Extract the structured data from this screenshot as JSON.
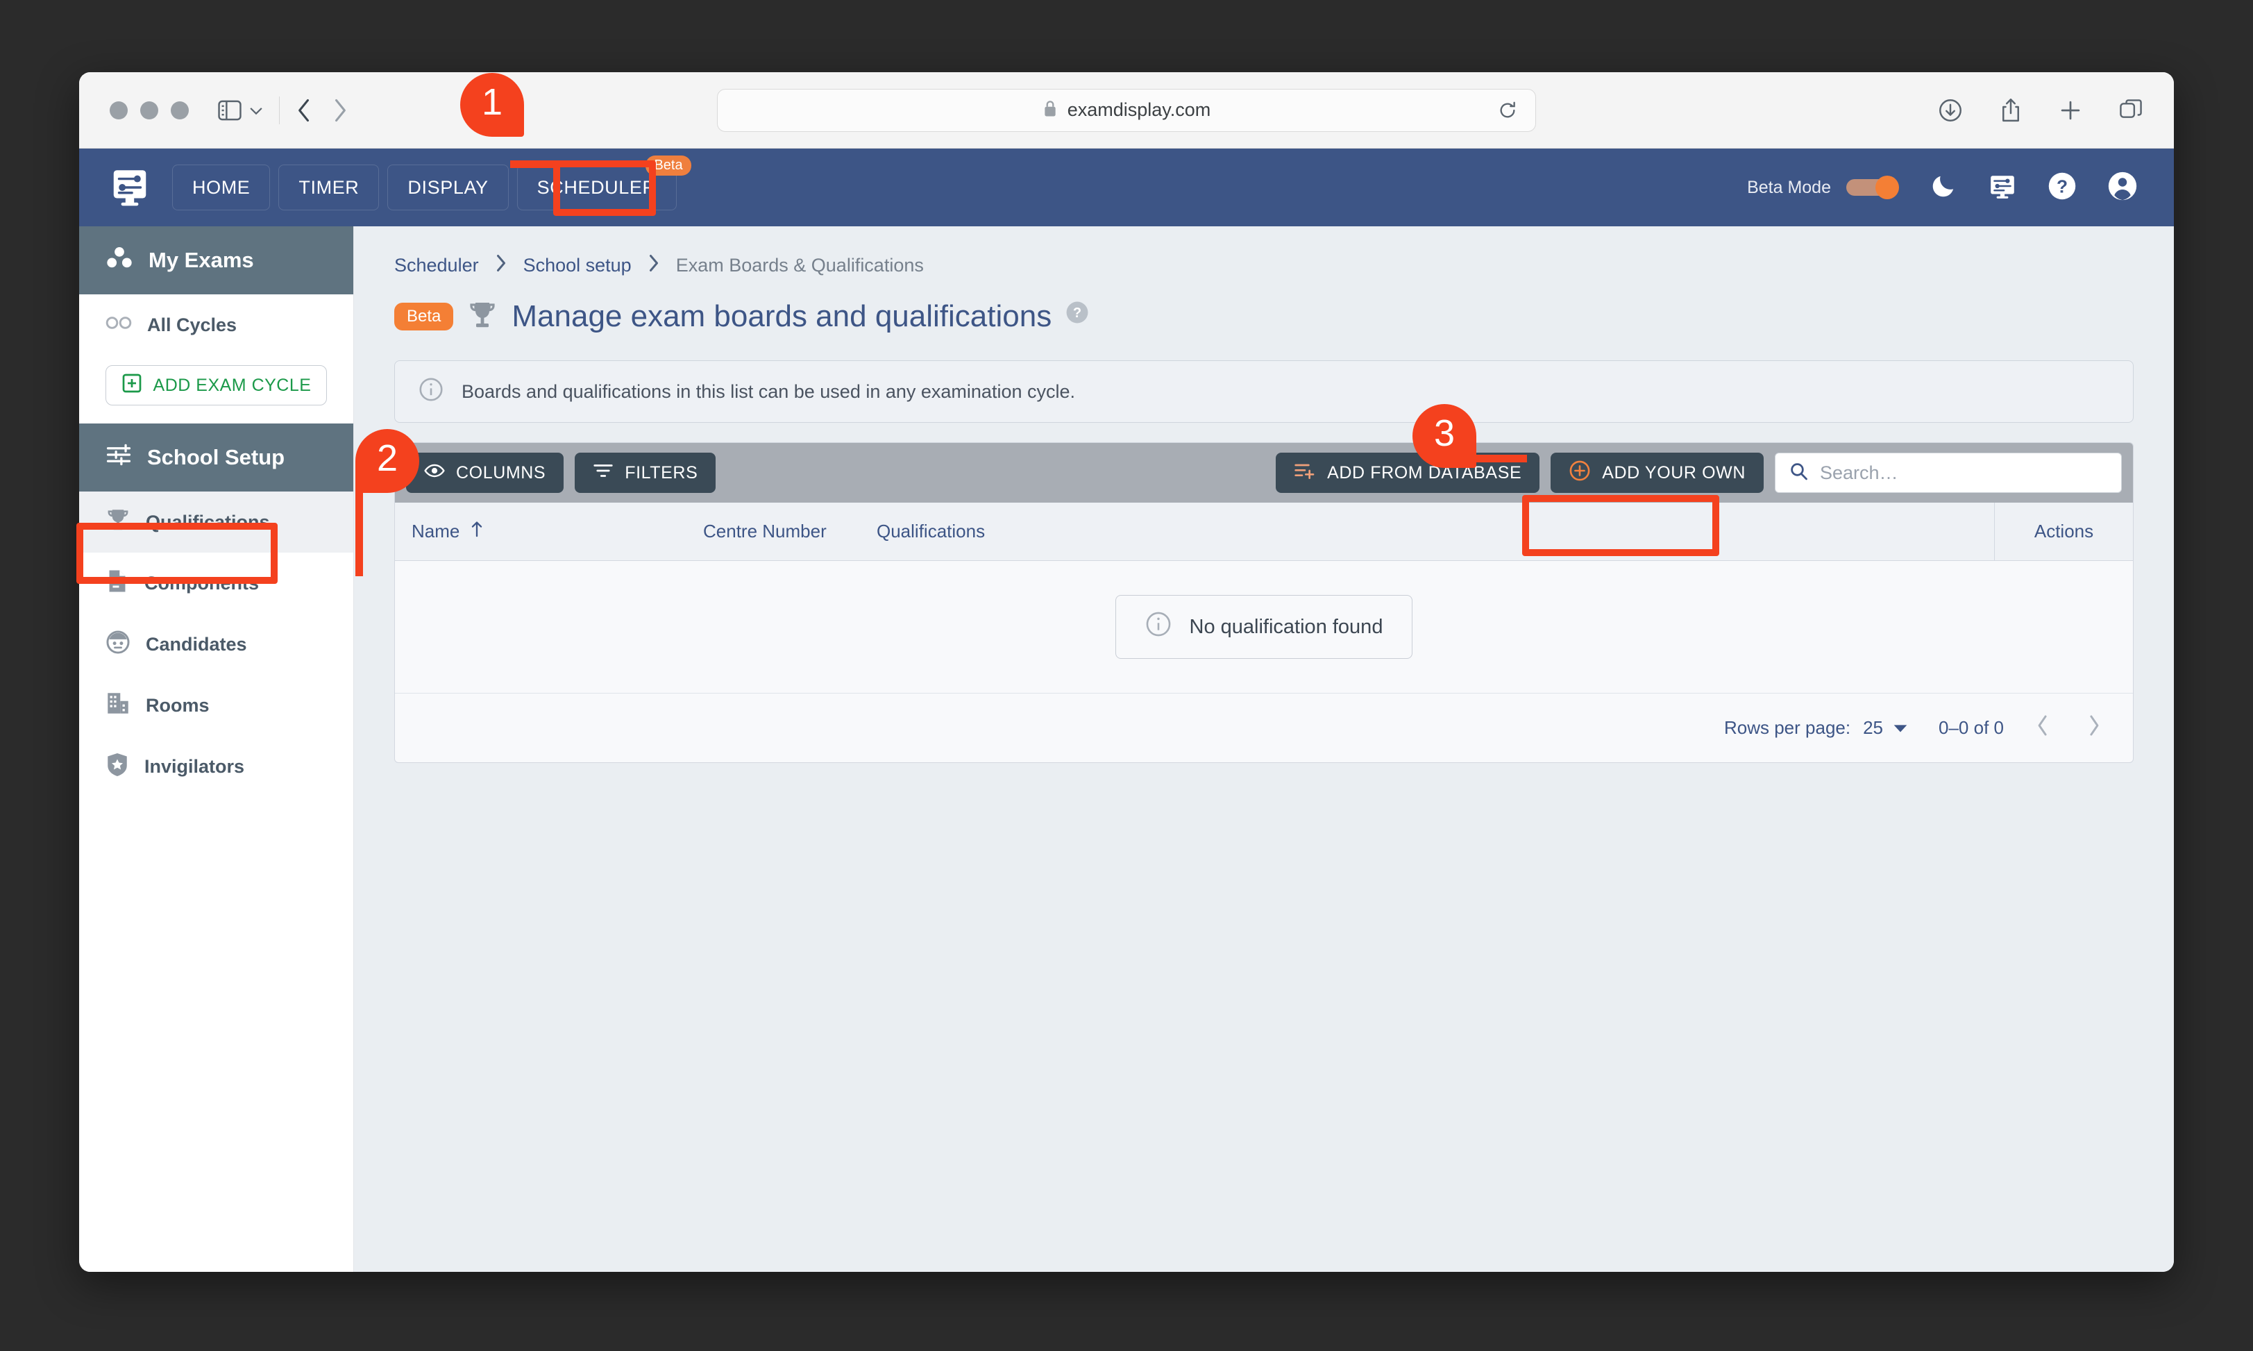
{
  "browser": {
    "url": "examdisplay.com",
    "lock_icon": "lock-icon",
    "reload_icon": "reload-icon",
    "back_icon": "chevron-left-icon",
    "forward_icon": "chevron-right-icon",
    "sidebar_icon": "sidebar-toggle-icon",
    "downloads_icon": "download-icon",
    "share_icon": "share-icon",
    "new_tab_icon": "plus-icon",
    "tab_overview_icon": "tab-overview-icon"
  },
  "topnav": {
    "logo_icon": "exam-display-logo-icon",
    "tabs": [
      {
        "label": "HOME",
        "badge": null
      },
      {
        "label": "TIMER",
        "badge": null
      },
      {
        "label": "DISPLAY",
        "badge": null
      },
      {
        "label": "SCHEDULER",
        "badge": "Beta"
      }
    ],
    "beta_mode_label": "Beta Mode",
    "beta_mode_on": true,
    "icons": [
      "dark-mode-moon-icon",
      "display-settings-icon",
      "help-question-icon",
      "account-avatar-icon"
    ]
  },
  "sidebar": {
    "my_exams": {
      "label": "My Exams",
      "icon": "my-exams-dots-icon"
    },
    "all_cycles": {
      "label": "All Cycles",
      "icon": "infinity-icon"
    },
    "add_exam_cycle": {
      "label": "ADD EXAM CYCLE",
      "icon": "plus-square-icon"
    },
    "school_setup": {
      "label": "School Setup",
      "icon": "settings-sliders-icon"
    },
    "items": [
      {
        "label": "Qualifications",
        "icon": "trophy-icon",
        "active": true
      },
      {
        "label": "Components",
        "icon": "document-icon",
        "active": false
      },
      {
        "label": "Candidates",
        "icon": "candidate-face-icon",
        "active": false
      },
      {
        "label": "Rooms",
        "icon": "building-icon",
        "active": false
      },
      {
        "label": "Invigilators",
        "icon": "shield-star-icon",
        "active": false
      }
    ]
  },
  "main": {
    "breadcrumb": [
      {
        "label": "Scheduler",
        "current": false
      },
      {
        "label": "School setup",
        "current": false
      },
      {
        "label": "Exam Boards & Qualifications",
        "current": true
      }
    ],
    "breadcrumb_separator": "›",
    "title_badge": "Beta",
    "title_icon": "trophy-icon",
    "title": "Manage exam boards and qualifications",
    "title_help_icon": "help-circle-icon",
    "info_banner": {
      "icon": "info-circle-icon",
      "text": "Boards and qualifications in this list can be used in any examination cycle."
    },
    "toolbar": {
      "columns_label": "COLUMNS",
      "columns_icon": "eye-icon",
      "filters_label": "FILTERS",
      "filters_icon": "filter-icon",
      "add_from_database_label": "ADD FROM DATABASE",
      "add_from_database_icon": "list-add-icon",
      "add_your_own_label": "ADD YOUR OWN",
      "add_your_own_icon": "plus-circle-icon",
      "search_placeholder": "Search…",
      "search_value": "",
      "search_icon": "search-icon"
    },
    "table": {
      "columns": [
        {
          "label": "Name",
          "sort": "asc",
          "sort_icon": "arrow-up-icon"
        },
        {
          "label": "Centre Number",
          "sort": null
        },
        {
          "label": "Qualifications",
          "sort": null
        },
        {
          "label": "Actions",
          "sort": null
        }
      ],
      "empty_state": {
        "icon": "info-circle-icon",
        "text": "No qualification found"
      },
      "rows": []
    },
    "footer": {
      "rows_per_page_label": "Rows per page:",
      "rows_per_page_value": "25",
      "rows_per_page_icon": "chevron-down-icon",
      "range_label": "0–0 of 0",
      "prev_icon": "chevron-left-icon",
      "next_icon": "chevron-right-icon"
    }
  },
  "annotations": {
    "accent_color": "#F4411E",
    "callouts": [
      {
        "number": "1",
        "target": "scheduler-tab"
      },
      {
        "number": "2",
        "target": "sidebar-item-qualifications"
      },
      {
        "number": "3",
        "target": "add-your-own-button"
      }
    ]
  }
}
